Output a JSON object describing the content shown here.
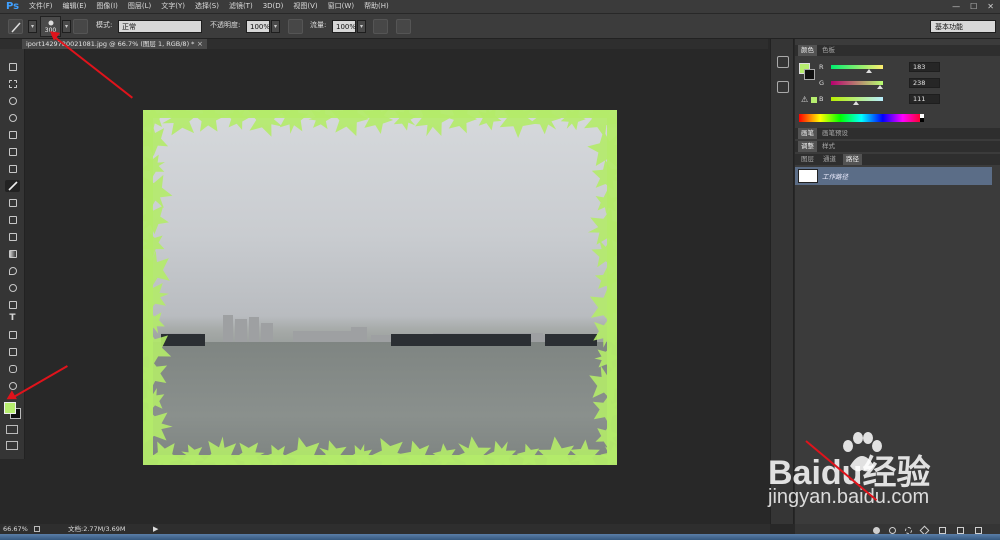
{
  "app": {
    "logo": "Ps"
  },
  "menu": [
    "文件(F)",
    "编辑(E)",
    "图像(I)",
    "图层(L)",
    "文字(Y)",
    "选择(S)",
    "滤镜(T)",
    "3D(D)",
    "视图(V)",
    "窗口(W)",
    "帮助(H)"
  ],
  "options": {
    "brush_size": "300",
    "mode_label": "模式:",
    "mode_value": "正常",
    "opacity_label": "不透明度:",
    "opacity_value": "100%",
    "flow_label": "流量:",
    "flow_value": "100%",
    "workspace": "基本功能"
  },
  "document": {
    "tab_title": "iport1429780021081.jpg @ 66.7% (图层 1, RGB/8) *",
    "close": "×"
  },
  "colors": {
    "foreground": "#b7ee6f",
    "background": "#0f0f0f",
    "accent_red": "#e0131b"
  },
  "color_panel": {
    "tabs": [
      "颜色",
      "色板"
    ],
    "r_label": "R",
    "r_value": "183",
    "g_label": "G",
    "g_value": "238",
    "b_label": "B",
    "b_value": "111"
  },
  "brush_panel": {
    "tabs": [
      "画笔",
      "画笔预设"
    ]
  },
  "adjust_panel": {
    "tabs": [
      "调整",
      "样式"
    ]
  },
  "layers_panel": {
    "tabs": [
      "图层",
      "通道",
      "路径"
    ],
    "path_item": "工作路径"
  },
  "status": {
    "zoom": "66.67%",
    "doc_info": "文档:2.77M/3.69M"
  },
  "watermark": {
    "brand": "Baidu经验",
    "url": "jingyan.baidu.com"
  }
}
